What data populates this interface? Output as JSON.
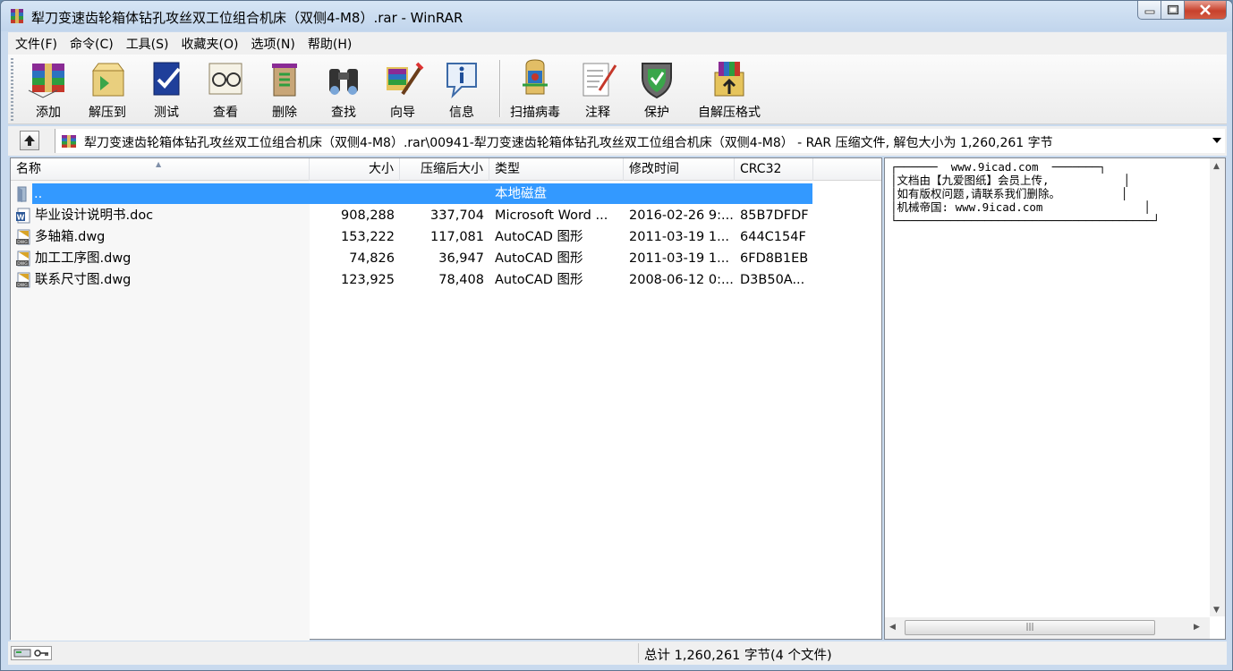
{
  "window": {
    "title": "犁刀变速齿轮箱体钻孔攻丝双工位组合机床（双侧4-M8）.rar - WinRAR"
  },
  "menu": [
    {
      "label": "文件(F)"
    },
    {
      "label": "命令(C)"
    },
    {
      "label": "工具(S)"
    },
    {
      "label": "收藏夹(O)"
    },
    {
      "label": "选项(N)"
    },
    {
      "label": "帮助(H)"
    }
  ],
  "toolbar": [
    {
      "label": "添加",
      "icon": "add-icon"
    },
    {
      "label": "解压到",
      "icon": "extract-icon"
    },
    {
      "label": "测试",
      "icon": "test-icon"
    },
    {
      "label": "查看",
      "icon": "view-icon"
    },
    {
      "label": "删除",
      "icon": "delete-icon"
    },
    {
      "label": "查找",
      "icon": "find-icon"
    },
    {
      "label": "向导",
      "icon": "wizard-icon"
    },
    {
      "label": "信息",
      "icon": "info-icon"
    },
    {
      "label": "扫描病毒",
      "icon": "virus-scan-icon"
    },
    {
      "label": "注释",
      "icon": "comment-icon"
    },
    {
      "label": "保护",
      "icon": "protect-icon"
    },
    {
      "label": "自解压格式",
      "icon": "sfx-icon"
    }
  ],
  "address": {
    "path": "犁刀变速齿轮箱体钻孔攻丝双工位组合机床（双侧4-M8）.rar\\00941-犁刀变速齿轮箱体钻孔攻丝双工位组合机床（双侧4-M8） - RAR 压缩文件, 解包大小为 1,260,261 字节"
  },
  "columns": {
    "name": "名称",
    "size": "大小",
    "packed": "压缩后大小",
    "type": "类型",
    "modified": "修改时间",
    "crc": "CRC32"
  },
  "files": [
    {
      "name": "..",
      "size": "",
      "packed": "",
      "type": "本地磁盘",
      "modified": "",
      "crc": "",
      "icon": "folder-up-icon"
    },
    {
      "name": "毕业设计说明书.doc",
      "size": "908,288",
      "packed": "337,704",
      "type": "Microsoft Word ...",
      "modified": "2016-02-26 9:...",
      "crc": "85B7DFDF",
      "icon": "word-doc-icon"
    },
    {
      "name": "多轴箱.dwg",
      "size": "153,222",
      "packed": "117,081",
      "type": "AutoCAD 图形",
      "modified": "2011-03-19 1...",
      "crc": "644C154F",
      "icon": "dwg-file-icon"
    },
    {
      "name": "加工工序图.dwg",
      "size": "74,826",
      "packed": "36,947",
      "type": "AutoCAD 图形",
      "modified": "2011-03-19 1...",
      "crc": "6FD8B1EB",
      "icon": "dwg-file-icon"
    },
    {
      "name": "联系尺寸图.dwg",
      "size": "123,925",
      "packed": "78,408",
      "type": "AutoCAD 图形",
      "modified": "2008-06-12 0:...",
      "crc": "D3B50A...",
      "icon": "dwg-file-icon"
    }
  ],
  "comment": {
    "text": "┌──────  www.9icad.com  ───────┐\n│文档由【九爱图纸】会员上传,           │\n│如有版权问题,请联系我们删除。         │\n│机械帝国: www.9icad.com               │\n└──────────────────────────────────────┘"
  },
  "status": {
    "summary": "总计 1,260,261 字节(4 个文件)"
  }
}
